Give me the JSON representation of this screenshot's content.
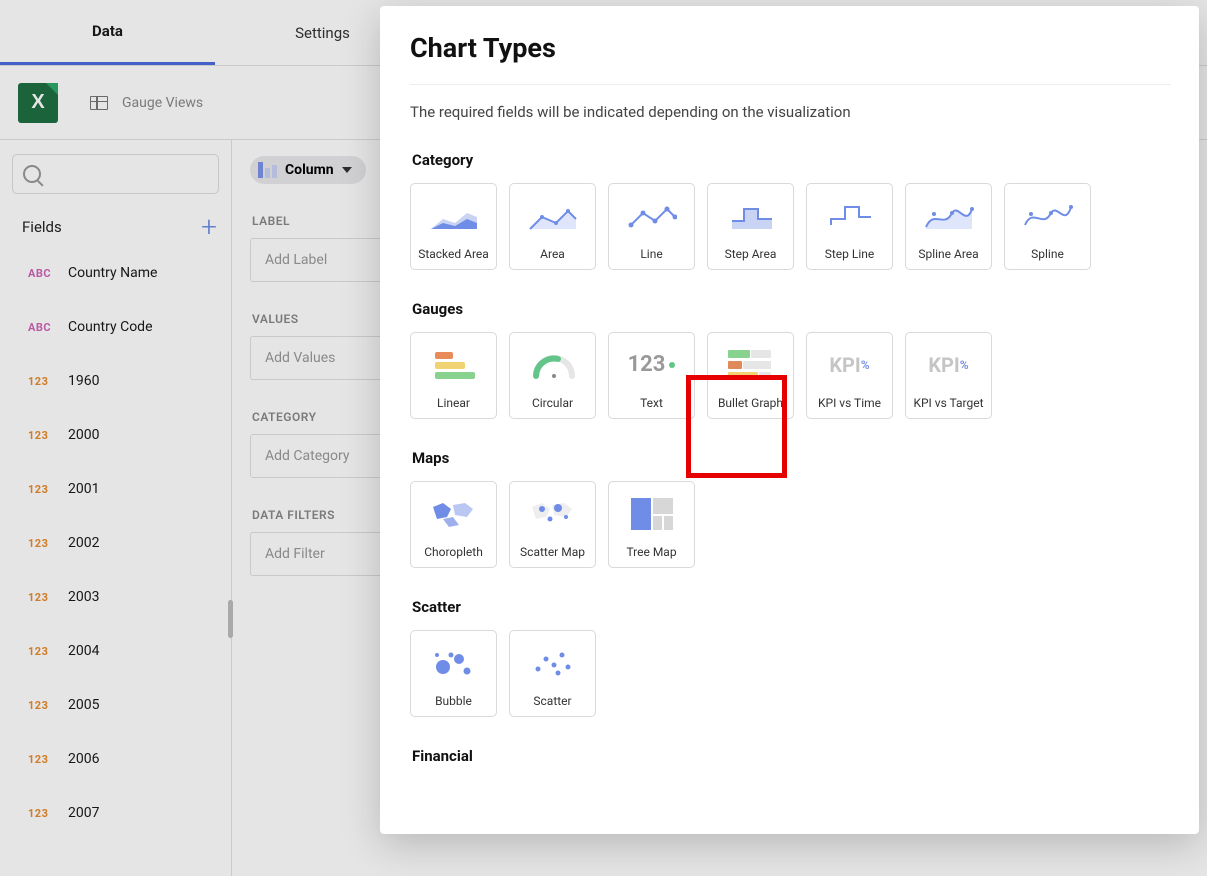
{
  "tabs": {
    "data": "Data",
    "settings": "Settings"
  },
  "datasource": {
    "name": "Gauge Views"
  },
  "fields_header": "Fields",
  "fields": [
    {
      "type": "ABC",
      "type_class": "abc",
      "name": "Country Name"
    },
    {
      "type": "ABC",
      "type_class": "abc",
      "name": "Country Code"
    },
    {
      "type": "123",
      "type_class": "num",
      "name": "1960"
    },
    {
      "type": "123",
      "type_class": "num",
      "name": "2000"
    },
    {
      "type": "123",
      "type_class": "num",
      "name": "2001"
    },
    {
      "type": "123",
      "type_class": "num",
      "name": "2002"
    },
    {
      "type": "123",
      "type_class": "num",
      "name": "2003"
    },
    {
      "type": "123",
      "type_class": "num",
      "name": "2004"
    },
    {
      "type": "123",
      "type_class": "num",
      "name": "2005"
    },
    {
      "type": "123",
      "type_class": "num",
      "name": "2006"
    },
    {
      "type": "123",
      "type_class": "num",
      "name": "2007"
    }
  ],
  "config": {
    "current_chart": "Column",
    "sections": {
      "label": {
        "title": "LABEL",
        "placeholder": "Add Label"
      },
      "values": {
        "title": "VALUES",
        "placeholder": "Add Values"
      },
      "category": {
        "title": "CATEGORY",
        "placeholder": "Add Category"
      },
      "filters": {
        "title": "DATA FILTERS",
        "placeholder": "Add Filter"
      }
    }
  },
  "modal": {
    "title": "Chart Types",
    "subtitle": "The required fields will be indicated depending on the visualization",
    "sections": {
      "category": {
        "title": "Category",
        "tiles": [
          "Stacked Area",
          "Area",
          "Line",
          "Step Area",
          "Step Line",
          "Spline Area",
          "Spline"
        ]
      },
      "gauges": {
        "title": "Gauges",
        "tiles": [
          "Linear",
          "Circular",
          "Text",
          "Bullet Graph",
          "KPI vs Time",
          "KPI vs Target"
        ]
      },
      "maps": {
        "title": "Maps",
        "tiles": [
          "Choropleth",
          "Scatter Map",
          "Tree Map"
        ]
      },
      "scatter": {
        "title": "Scatter",
        "tiles": [
          "Bubble",
          "Scatter"
        ]
      },
      "financial": {
        "title": "Financial"
      }
    }
  }
}
